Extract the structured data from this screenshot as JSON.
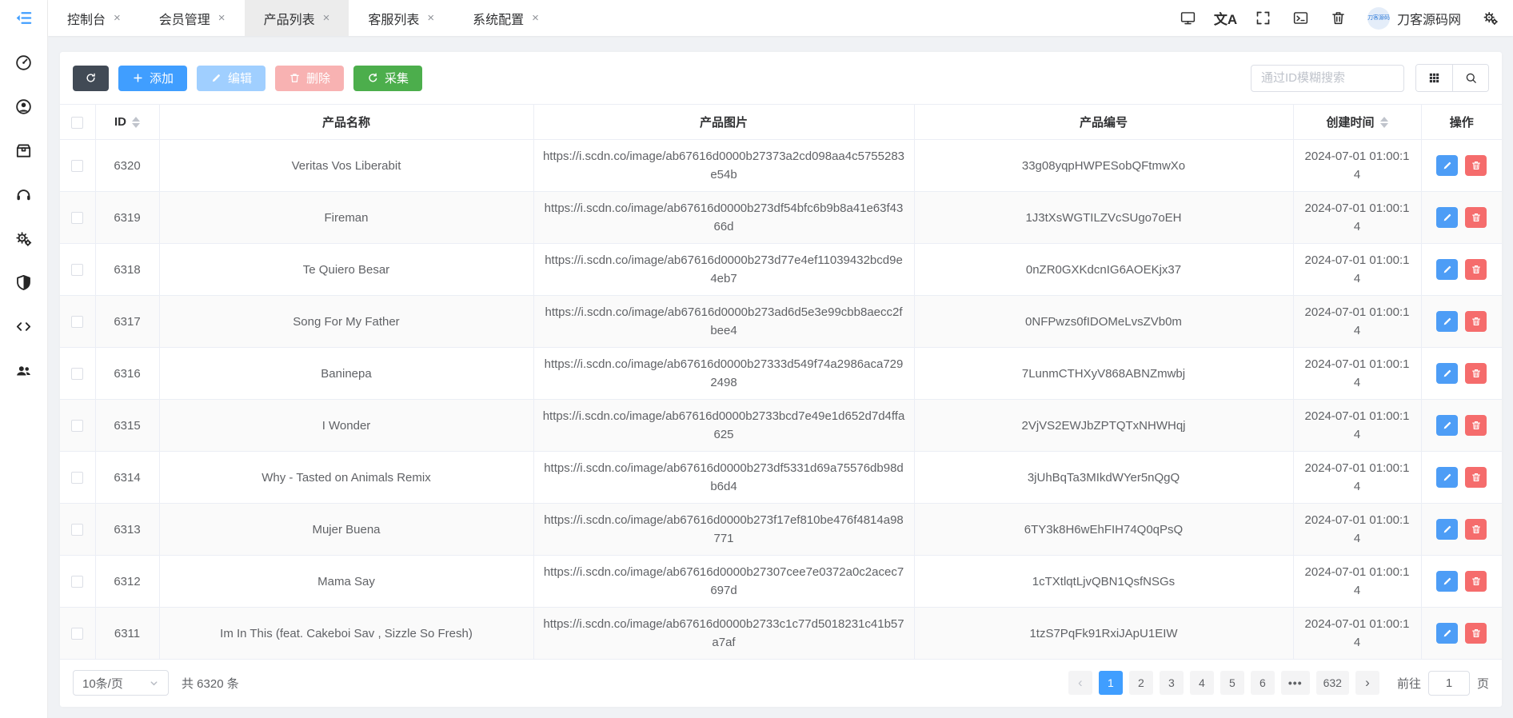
{
  "glyphs": {
    "close": "×",
    "prev": "‹",
    "next": "›",
    "translate": "文A"
  },
  "tabbar": {
    "tabs": [
      {
        "label": "控制台",
        "active": false
      },
      {
        "label": "会员管理",
        "active": false
      },
      {
        "label": "产品列表",
        "active": true
      },
      {
        "label": "客服列表",
        "active": false
      },
      {
        "label": "系统配置",
        "active": false
      }
    ],
    "brand": "刀客源码网",
    "avatar_text": "刀客源码"
  },
  "sidebar": {
    "icons": [
      "dashboard",
      "user",
      "package",
      "headset",
      "settings-gears",
      "shield",
      "code",
      "team"
    ]
  },
  "toolbar": {
    "add_label": "添加",
    "edit_label": "编辑",
    "delete_label": "删除",
    "collect_label": "采集"
  },
  "search": {
    "placeholder": "通过ID模糊搜索"
  },
  "table": {
    "headers": {
      "id": "ID",
      "name": "产品名称",
      "image": "产品图片",
      "code": "产品编号",
      "created": "创建时间",
      "actions": "操作"
    },
    "rows": [
      {
        "id": "6320",
        "name": "Veritas Vos Liberabit",
        "image": "https://i.scdn.co/image/ab67616d0000b27373a2cd098aa4c5755283e54b",
        "code": "33g08yqpHWPESobQFtmwXo",
        "created": "2024-07-01 01:00:14"
      },
      {
        "id": "6319",
        "name": "Fireman",
        "image": "https://i.scdn.co/image/ab67616d0000b273df54bfc6b9b8a41e63f4366d",
        "code": "1J3tXsWGTILZVcSUgo7oEH",
        "created": "2024-07-01 01:00:14"
      },
      {
        "id": "6318",
        "name": "Te Quiero Besar",
        "image": "https://i.scdn.co/image/ab67616d0000b273d77e4ef11039432bcd9e4eb7",
        "code": "0nZR0GXKdcnIG6AOEKjx37",
        "created": "2024-07-01 01:00:14"
      },
      {
        "id": "6317",
        "name": "Song For My Father",
        "image": "https://i.scdn.co/image/ab67616d0000b273ad6d5e3e99cbb8aecc2fbee4",
        "code": "0NFPwzs0fIDOMeLvsZVb0m",
        "created": "2024-07-01 01:00:14"
      },
      {
        "id": "6316",
        "name": "Baninepa",
        "image": "https://i.scdn.co/image/ab67616d0000b27333d549f74a2986aca7292498",
        "code": "7LunmCTHXyV868ABNZmwbj",
        "created": "2024-07-01 01:00:14"
      },
      {
        "id": "6315",
        "name": "I Wonder",
        "image": "https://i.scdn.co/image/ab67616d0000b2733bcd7e49e1d652d7d4ffa625",
        "code": "2VjVS2EWJbZPTQTxNHWHqj",
        "created": "2024-07-01 01:00:14"
      },
      {
        "id": "6314",
        "name": "Why - Tasted on Animals Remix",
        "image": "https://i.scdn.co/image/ab67616d0000b273df5331d69a75576db98db6d4",
        "code": "3jUhBqTa3MIkdWYer5nQgQ",
        "created": "2024-07-01 01:00:14"
      },
      {
        "id": "6313",
        "name": "Mujer Buena",
        "image": "https://i.scdn.co/image/ab67616d0000b273f17ef810be476f4814a98771",
        "code": "6TY3k8H6wEhFIH74Q0qPsQ",
        "created": "2024-07-01 01:00:14"
      },
      {
        "id": "6312",
        "name": "Mama Say",
        "image": "https://i.scdn.co/image/ab67616d0000b27307cee7e0372a0c2acec7697d",
        "code": "1cTXtlqtLjvQBN1QsfNSGs",
        "created": "2024-07-01 01:00:14"
      },
      {
        "id": "6311",
        "name": "Im In This (feat. Cakeboi Sav , Sizzle So Fresh)",
        "image": "https://i.scdn.co/image/ab67616d0000b2733c1c77d5018231c41b57a7af",
        "code": "1tzS7PqFk91RxiJApU1EIW",
        "created": "2024-07-01 01:00:14"
      }
    ]
  },
  "pagination": {
    "page_size": "10条/页",
    "total": "共 6320 条",
    "pages": [
      "1",
      "2",
      "3",
      "4",
      "5",
      "6",
      "•••",
      "632"
    ],
    "active_page": "1",
    "goto_label": "前往",
    "goto_value": "1",
    "goto_suffix": "页"
  }
}
